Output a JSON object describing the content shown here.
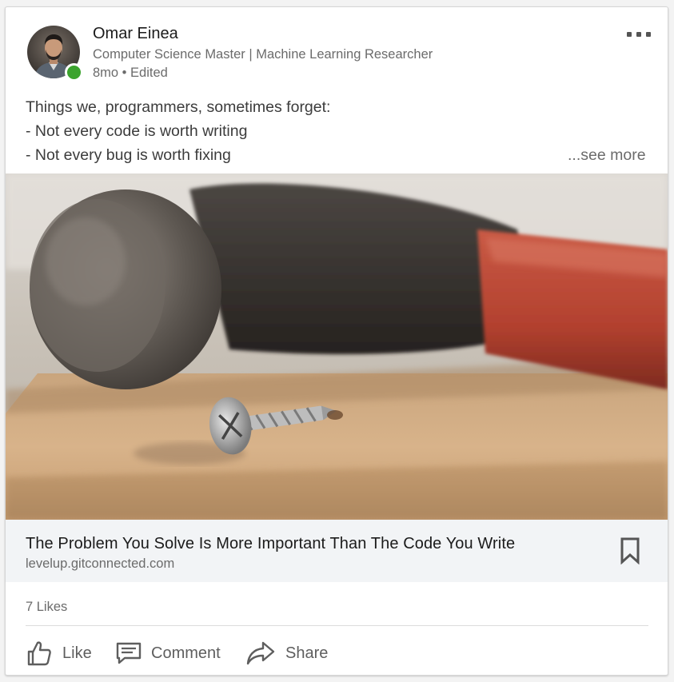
{
  "author": {
    "name": "Omar Einea",
    "headline": "Computer Science Master | Machine Learning Researcher",
    "meta": "8mo • Edited",
    "online_color": "#3ba32d",
    "avatar_icon": "profile-photo"
  },
  "menu": {
    "icon": "more-horizontal-icon"
  },
  "post": {
    "lines": [
      "Things we, programmers, sometimes forget:",
      "- Not every code is worth writing",
      "- Not every bug is worth fixing"
    ],
    "see_more": "...see more"
  },
  "article": {
    "image_subject": "hammer-and-screw-photo",
    "title": "The Problem You Solve Is More Important Than The Code You Write",
    "domain": "levelup.gitconnected.com",
    "bookmark_icon": "bookmark-icon"
  },
  "social": {
    "likes": "7 Likes"
  },
  "actions": [
    {
      "label": "Like",
      "icon": "thumbs-up-icon"
    },
    {
      "label": "Comment",
      "icon": "comment-icon"
    },
    {
      "label": "Share",
      "icon": "share-arrow-icon"
    }
  ]
}
